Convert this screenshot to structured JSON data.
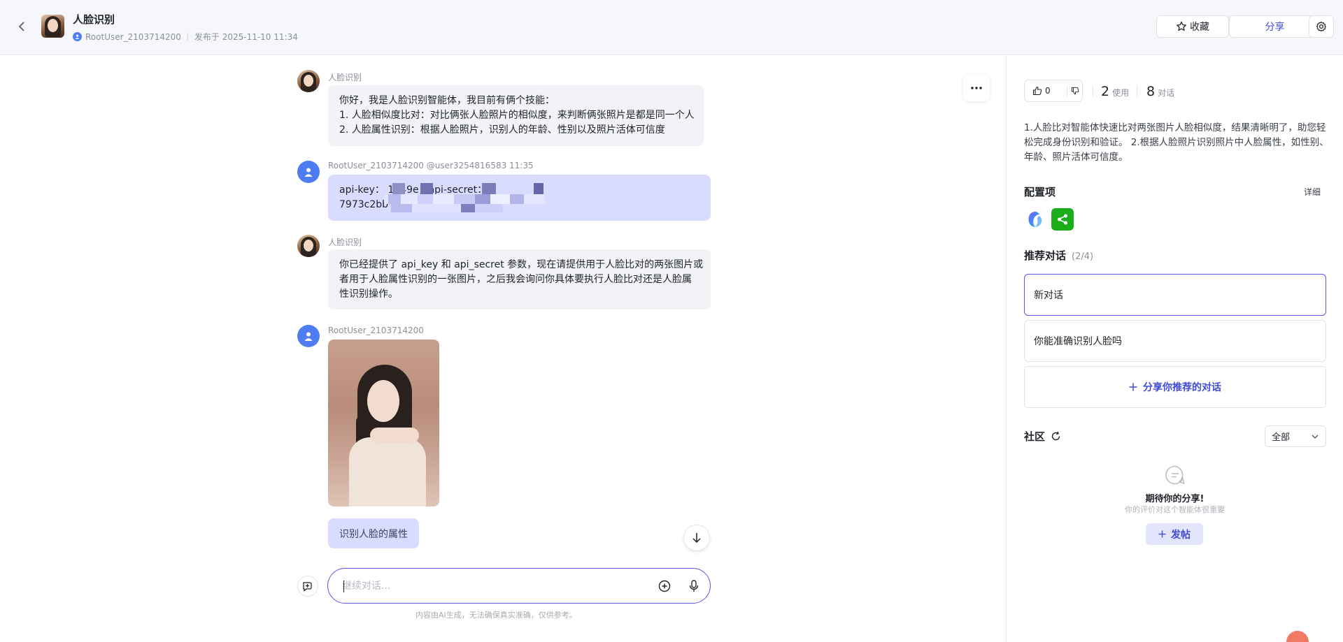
{
  "header": {
    "title": "人脸识别",
    "author": "RootUser_2103714200",
    "published": "发布于 2025-11-10 11:34",
    "favorite_label": "收藏",
    "share_label": "分享"
  },
  "chat": {
    "messages": [
      {
        "sender": "人脸识别",
        "lines": [
          "你好，我是人脸识别智能体，我目前有俩个技能：",
          "1. 人脸相似度比对：对比俩张人脸照片的相似度，来判断俩张照片是都是同一个人",
          "2. 人脸属性识别：根据人脸照片，识别人的年龄、性别以及照片活体可信度"
        ]
      },
      {
        "sender": "RootUser_2103714200 @user3254816583  11:35",
        "lines": [
          "api-key：                                 1d49e，api-secret：",
          "7973c2bb                                     52"
        ]
      },
      {
        "sender": "人脸识别",
        "lines": [
          "你已经提供了 api_key 和 api_secret 参数，现在请提供用于人脸比对的两张图片或",
          "者用于人脸属性识别的一张图片，之后我会询问你具体要执行人脸比对还是人脸属",
          "性识别操作。"
        ]
      },
      {
        "sender": "RootUser_2103714200",
        "text": "识别人脸的属性"
      }
    ],
    "input_placeholder": "继续对话...",
    "disclaimer": "内容由AI生成，无法确保真实准确，仅供参考。"
  },
  "panel": {
    "likes": "0",
    "uses_count": "2",
    "uses_label": "使用",
    "conversations_count": "8",
    "conversations_label": "对话",
    "description": "1.人脸比对智能体快速比对两张图片人脸相似度，结果清晰明了，助您轻松完成身份识别和验证。 2.根据人脸照片识别照片中人脸属性，如性别、年龄、照片活体可信度。",
    "config_title": "配置项",
    "config_detail": "详细",
    "recommend_title": "推荐对话",
    "recommend_count": "(2/4)",
    "recommend_items": [
      "新对话",
      "你能准确识别人脸吗"
    ],
    "share_recommend": "分享你推荐的对话",
    "community_title": "社区",
    "community_filter": "全部",
    "empty_title": "期待你的分享!",
    "empty_subtitle": "你的评价对这个智能体很重要",
    "post_label": "发帖"
  },
  "colors": {
    "accent": "#3f4ad6",
    "user_bubble": "#d9dbff",
    "bot_bubble": "#f2f3f7",
    "input_border": "#5a55e6",
    "wechat_green": "#1aad19"
  }
}
